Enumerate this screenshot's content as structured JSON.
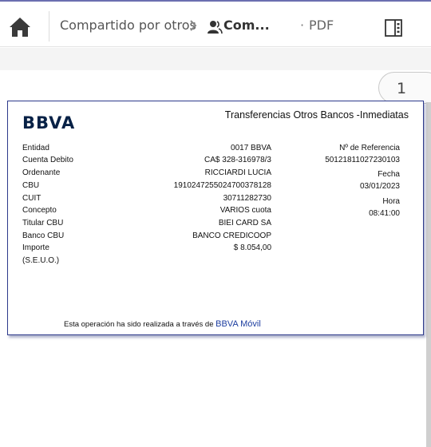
{
  "header": {
    "breadcrumb_root": "Compartido por otros",
    "breadcrumb_current": "Com...",
    "dot": "·",
    "file_type": "PDF"
  },
  "viewer": {
    "page_number": "1"
  },
  "receipt": {
    "logo": "BBVA",
    "title": "Transferencias Otros Bancos -Inmediatas",
    "labels": [
      "Entidad",
      "Cuenta Debito",
      "Ordenante",
      "CBU",
      "CUIT",
      "Concepto",
      "Titular CBU",
      "Banco CBU",
      "Importe",
      "(S.E.U.O.)"
    ],
    "values": [
      "0017 BBVA",
      "CA$ 328-316978/3",
      "RICCIARDI LUCIA",
      "191024725502470037812​8",
      "30711282730",
      "VARIOS cuota",
      "BIEI CARD SA",
      "BANCO CREDICOOP",
      "$ 8.054,00"
    ],
    "ref_label": "Nº de Referencia",
    "ref_value": "50121811027230103",
    "date_label": "Fecha",
    "date_value": "03/01/2023",
    "time_label": "Hora",
    "time_value": "08:41:00",
    "footer_text": "Esta operación ha sido realizada a través de",
    "footer_brand": "BBVA Móvil"
  },
  "colors": {
    "brand_navy": "#072146",
    "accent_blue": "#1d3ea0",
    "frame_border": "#2d3a8c"
  },
  "icons": [
    "home-icon",
    "chevron-right-icon",
    "shared-person-icon",
    "panel-toggle-icon"
  ]
}
